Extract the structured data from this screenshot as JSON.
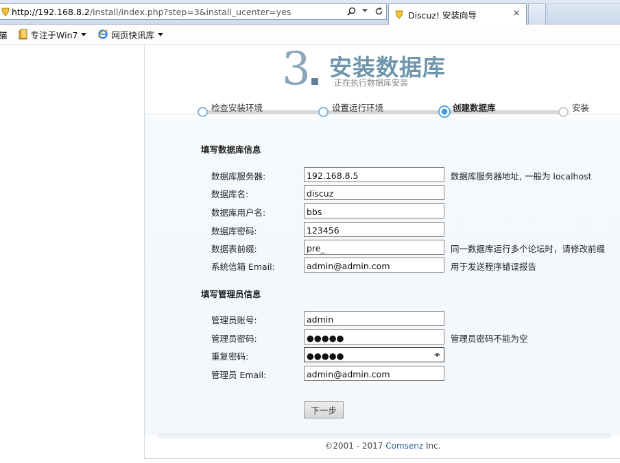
{
  "browser": {
    "url_host": "http://192.168.8.2",
    "url_path": "/install/index.php?step=3&install_ucenter=yes",
    "tab_title": "Discuz! 安装向导",
    "tab_close": "×",
    "favorites": [
      {
        "label": "猫",
        "icon": "none"
      },
      {
        "label": "专注于Win7",
        "icon": "folder-icon"
      },
      {
        "label": "网页快讯库",
        "icon": "ie-icon"
      }
    ]
  },
  "header": {
    "step_number": "3",
    "title": "安装数据库",
    "subtitle": "正在执行数据库安装"
  },
  "progress": {
    "steps": [
      {
        "label": "检查安装环境",
        "state": "done"
      },
      {
        "label": "设置运行环境",
        "state": "done"
      },
      {
        "label": "创建数据库",
        "state": "current"
      },
      {
        "label": "安装",
        "state": "pending"
      }
    ]
  },
  "db_section": {
    "title": "填写数据库信息",
    "rows": [
      {
        "label": "数据库服务器:",
        "value": "192.168.8.5",
        "hint": "数据库服务器地址, 一般为 localhost"
      },
      {
        "label": "数据库名:",
        "value": "discuz",
        "hint": ""
      },
      {
        "label": "数据库用户名:",
        "value": "bbs",
        "hint": ""
      },
      {
        "label": "数据库密码:",
        "value": "123456",
        "hint": ""
      },
      {
        "label": "数据表前缀:",
        "value": "pre_",
        "hint": "同一数据库运行多个论坛时，请修改前缀"
      },
      {
        "label": "系统信箱 Email:",
        "value": "admin@admin.com",
        "hint": "用于发送程序错误报告"
      }
    ]
  },
  "admin_section": {
    "title": "填写管理员信息",
    "rows": [
      {
        "label": "管理员账号:",
        "value": "admin",
        "hint": "",
        "type": "text"
      },
      {
        "label": "管理员密码:",
        "value": "●●●●●",
        "hint": "管理员密码不能为空",
        "type": "password"
      },
      {
        "label": "重复密码:",
        "value": "●●●●●",
        "hint": "",
        "type": "password",
        "focused": true
      },
      {
        "label": "管理员 Email:",
        "value": "admin@admin.com",
        "hint": "",
        "type": "text"
      }
    ]
  },
  "actions": {
    "next_label": "下一步"
  },
  "footer": {
    "copyright": "©2001 - 2017 ",
    "brand": "Comsenz",
    "suffix": " Inc."
  },
  "colors": {
    "title": "#6d95ab",
    "step_number": "#8aa6bb",
    "progress_dot": "#5aa5dd",
    "brand_link": "#2a5fa0"
  }
}
